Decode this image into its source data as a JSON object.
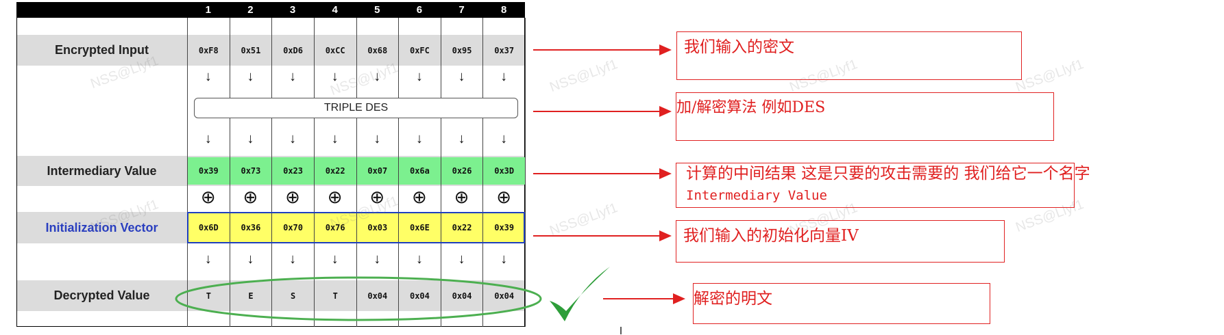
{
  "columns": [
    "1",
    "2",
    "3",
    "4",
    "5",
    "6",
    "7",
    "8"
  ],
  "rows": {
    "encrypted": {
      "label": "Encrypted Input",
      "values": [
        "0xF8",
        "0x51",
        "0xD6",
        "0xCC",
        "0x68",
        "0xFC",
        "0x95",
        "0x37"
      ]
    },
    "cipher": {
      "label": "TRIPLE DES"
    },
    "intermediary": {
      "label": "Intermediary Value",
      "values": [
        "0x39",
        "0x73",
        "0x23",
        "0x22",
        "0x07",
        "0x6a",
        "0x26",
        "0x3D"
      ]
    },
    "iv": {
      "label": "Initialization Vector",
      "values": [
        "0x6D",
        "0x36",
        "0x70",
        "0x76",
        "0x03",
        "0x6E",
        "0x22",
        "0x39"
      ]
    },
    "decrypted": {
      "label": "Decrypted Value",
      "values": [
        "T",
        "E",
        "S",
        "T",
        "0x04",
        "0x04",
        "0x04",
        "0x04"
      ]
    }
  },
  "symbols": {
    "arrow": "↓",
    "xor": "⊕",
    "check": "✓"
  },
  "annotations": [
    {
      "line1": "我们输入的密文"
    },
    {
      "line1": "加/解密算法 例如DES"
    },
    {
      "line1": "计算的中间结果 这是只要的攻击需要的 我们给它一个名字",
      "line2": "Intermediary Value"
    },
    {
      "line1": "我们输入的初始化向量IV"
    },
    {
      "line1": "解密的明文"
    }
  ],
  "watermark": "NSS@Llyf1",
  "colors": {
    "header_bg": "#000000",
    "row_band": "#dcdcdc",
    "intermediary_fill": "#7cf08f",
    "iv_fill": "#ffff66",
    "iv_border": "#1e3fbf",
    "iv_label": "#2a3fbf",
    "ellipse": "#4caf50",
    "check": "#2e9e3a",
    "annotation": "#e02020"
  }
}
